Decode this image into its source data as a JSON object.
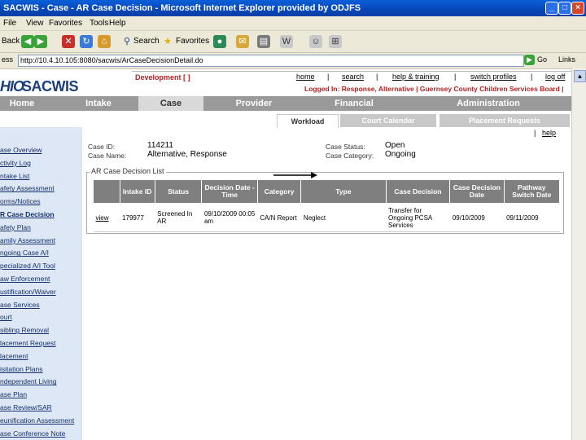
{
  "window": {
    "title": "SACWIS - Case - AR Case Decision - Microsoft Internet Explorer provided by ODJFS"
  },
  "menubar": [
    "File",
    "View",
    "Favorites",
    "Tools",
    "Help"
  ],
  "toolbar": {
    "back_label": "Back",
    "search_label": "Search",
    "favorites_label": "Favorites"
  },
  "addressbar": {
    "label": "ess",
    "url": "http://10.4.10.105:8080/sacwis/ArCaseDecisionDetail.do",
    "go_label": "Go",
    "links_label": "Links"
  },
  "header": {
    "logo_a": "HIO",
    "logo_b": "SACWIS",
    "environment": "Development [ ]",
    "links": [
      "home",
      "search",
      "help & training",
      "switch profiles",
      "log off"
    ],
    "logged_in": "Logged In: Response, Alternative | Guernsey County Children Services Board |"
  },
  "nav": {
    "tabs": [
      "Home",
      "Intake",
      "Case",
      "Provider",
      "Financial",
      "Administration"
    ]
  },
  "subnav": {
    "tabs": [
      "Workload",
      "Court Calendar",
      "Placement Requests"
    ],
    "help": "help"
  },
  "sidebar": {
    "items": [
      "ase Overview",
      "ctivity Log",
      "ntake List",
      "afety Assessment",
      "orms/Notices",
      "R Case Decision",
      "afety Plan",
      "amily Assessment",
      "ngoing Case A/I",
      "pecialized A/I Tool",
      "aw Enforcement",
      "ustification/Waiver",
      "ase Services",
      "ourt",
      "sibling Removal",
      "lacement Request",
      "lacement",
      "isitation Plans",
      "ndependent Living",
      "ase Plan",
      "ase Review/SAR",
      "eunification Assessment",
      "ase Conference Note"
    ]
  },
  "case_info": {
    "case_id_label": "Case ID:",
    "case_id": "114211",
    "case_name_label": "Case Name:",
    "case_name": "Alternative, Response",
    "case_status_label": "Case Status:",
    "case_status": "Open",
    "case_category_label": "Case Category:",
    "case_category": "Ongoing"
  },
  "decision_list": {
    "legend": "AR Case Decision List",
    "columns": [
      "",
      "Intake ID",
      "Status",
      "Decision Date - Time",
      "Category",
      "Type",
      "Case Decision",
      "Case Decision Date",
      "Pathway Switch Date"
    ],
    "rows": [
      {
        "action": "view",
        "intake_id": "179977",
        "status": "Screened In AR",
        "decision_datetime": "09/10/2009 00:05 am",
        "category": "CA/N Report",
        "type": "Neglect",
        "case_decision": "Transfer for Ongoing PCSA Services",
        "case_decision_date": "09/10/2009",
        "pathway_switch_date": "09/11/2009"
      }
    ]
  },
  "colors": {
    "titlebar": "#0a4fc8",
    "nav_gray": "#9a9a9a",
    "table_header": "#7f7f7f",
    "sidebar_bg": "#dde7f5",
    "link_red": "#b22222"
  }
}
